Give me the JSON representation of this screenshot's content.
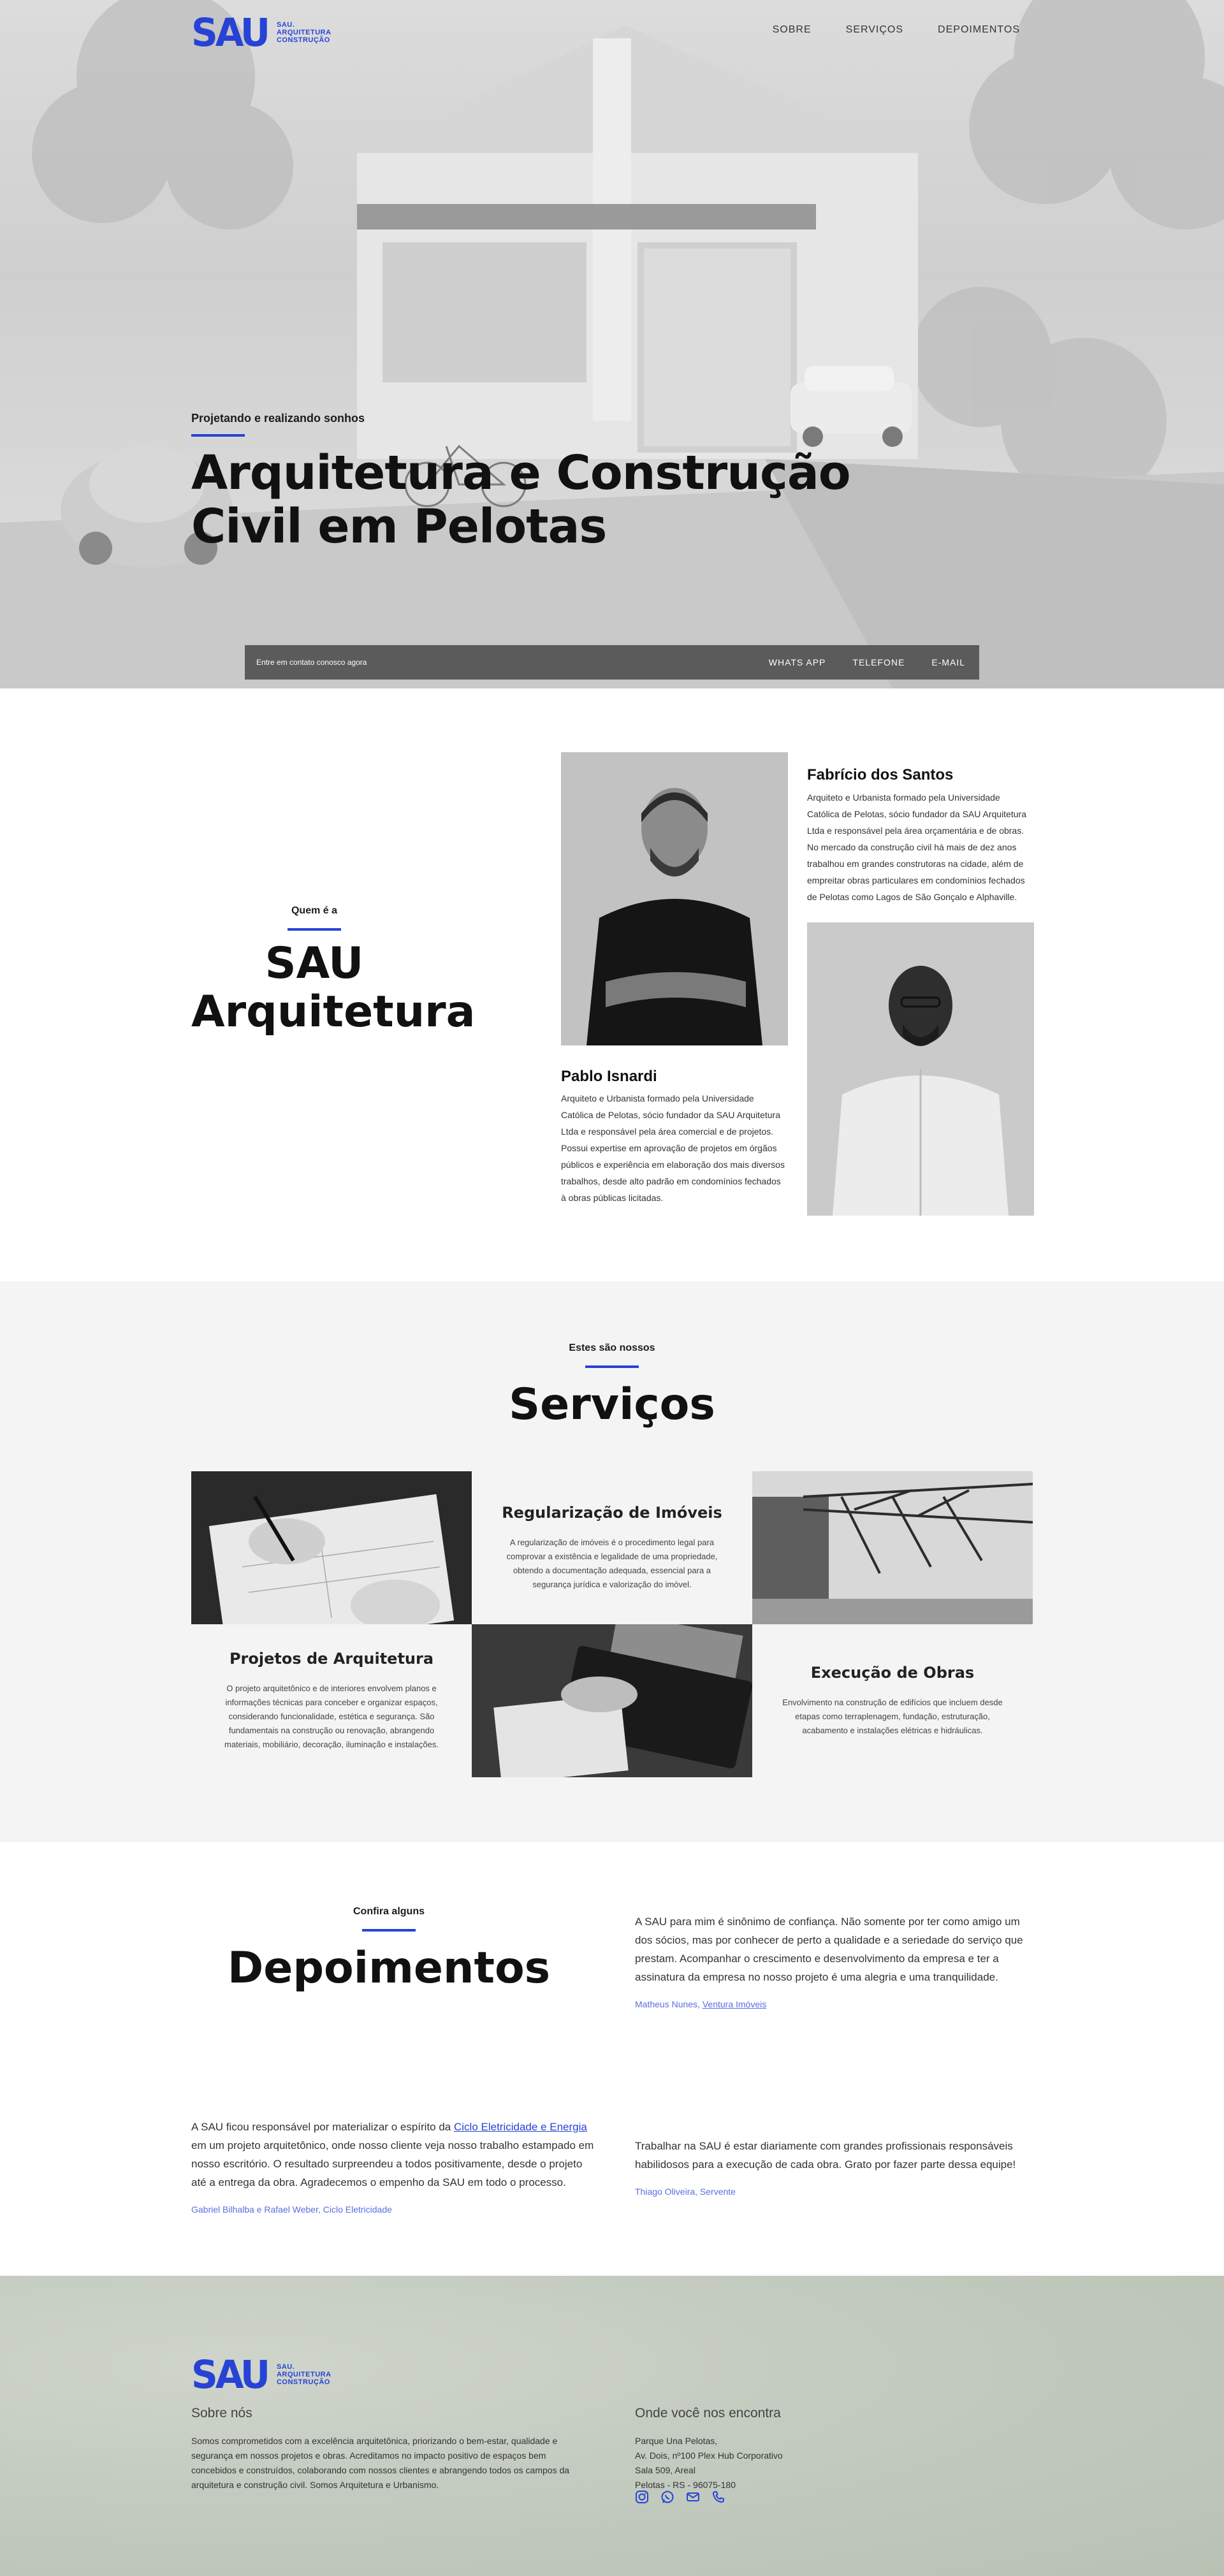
{
  "brand": {
    "mark": "SAU",
    "sub_line1": "SAU.",
    "sub_line2": "ARQUITETURA",
    "sub_line3": "CONSTRUÇÃO",
    "accent_color": "#2743d6"
  },
  "nav": {
    "items": [
      {
        "label": "SOBRE"
      },
      {
        "label": "SERVIÇOS"
      },
      {
        "label": "DEPOIMENTOS"
      }
    ]
  },
  "hero": {
    "kicker": "Projetando e realizando sonhos",
    "title": "Arquitetura e Construção Civil em Pelotas",
    "contact_text": "Entre em contato conosco agora",
    "contact_links": [
      "WHATS APP",
      "TELEFONE",
      "E-MAIL"
    ]
  },
  "about": {
    "kicker": "Quem é a",
    "title": "SAU Arquitetura",
    "people": [
      {
        "name": "Fabrício dos Santos",
        "bio": "Arquiteto e Urbanista formado pela Universidade Católica de Pelotas, sócio fundador da SAU Arquitetura Ltda e responsável pela área orçamentária e de obras. No mercado da construção civil há mais de dez anos trabalhou em grandes construtoras na cidade, além de empreitar obras particulares em condomínios fechados de Pelotas como Lagos de São Gonçalo e Alphaville."
      },
      {
        "name": "Pablo Isnardi",
        "bio": "Arquiteto e Urbanista formado pela Universidade Católica de Pelotas, sócio fundador da SAU Arquitetura Ltda e responsável pela área comercial e de projetos. Possui expertise em aprovação de projetos em órgãos públicos e experiência em elaboração dos mais diversos trabalhos, desde alto padrão em condomínios fechados à obras públicas licitadas."
      }
    ]
  },
  "services": {
    "kicker": "Estes são nossos",
    "title": "Serviços",
    "items": [
      {
        "title": "Regularização de Imóveis",
        "text": "A regularização de imóveis é o procedimento legal para comprovar a existência e legalidade de uma propriedade, obtendo a documentação adequada, essencial para a segurança jurídica e valorização do imóvel."
      },
      {
        "title": "Projetos de Arquitetura",
        "text": "O projeto arquitetônico e de interiores envolvem planos e informações técnicas para conceber e organizar espaços, considerando funcionalidade, estética e segurança. São fundamentais na construção ou renovação, abrangendo materiais, mobiliário, decoração, iluminação e instalações."
      },
      {
        "title": "Execução de Obras",
        "text": "Envolvimento na construção de edifícios que incluem desde etapas como terraplenagem, fundação, estruturação, acabamento e instalações elétricas e hidráulicas."
      }
    ]
  },
  "testimonials": {
    "kicker": "Confira alguns",
    "title": "Depoimentos",
    "items": [
      {
        "text": "A SAU para mim é sinônimo de confiança. Não somente por ter como amigo um dos sócios, mas por conhecer de perto a qualidade e a seriedade do serviço que prestam. Acompanhar o crescimento e desenvolvimento da empresa e ter a assinatura da empresa no nosso projeto é uma alegria e uma tranquilidade.",
        "author": "Matheus Nunes,",
        "company": "Ventura Imóveis"
      },
      {
        "text_before": "A SAU ficou responsável por materializar o espírito da",
        "link": "Ciclo Eletricidade e Energia",
        "text_after": "em um projeto arquitetônico, onde nosso cliente veja nosso trabalho estampado em nosso escritório. O resultado surpreendeu a todos positivamente, desde o projeto até a entrega da obra. Agradecemos o empenho da SAU em todo o processo.",
        "author": "Gabriel Bilhalba e Rafael Weber, Ciclo Eletricidade"
      },
      {
        "text": "Trabalhar na SAU é estar diariamente com grandes profissionais responsáveis habilidosos para a execução de cada obra. Grato por fazer parte dessa equipe!",
        "author": "Thiago Oliveira, Servente"
      }
    ]
  },
  "footer": {
    "about_title": "Sobre nós",
    "about_text": "Somos comprometidos com a excelência arquitetônica, priorizando o bem-estar, qualidade e segurança em nossos projetos e obras. Acreditamos no impacto positivo de espaços bem concebidos e construídos, colaborando com nossos clientes e abrangendo todos os campos da arquitetura e construção civil. Somos Arquitetura e Urbanismo.",
    "location_title": "Onde você nos encontra",
    "address_line1": "Parque Una Pelotas,",
    "address_line2": "Av. Dois, nº100 Plex Hub Corporativo",
    "address_line3": "Sala 509, Areal",
    "address_line4": "Pelotas - RS - 96075-180",
    "social_icons": [
      "instagram-icon",
      "whatsapp-icon",
      "email-icon",
      "phone-icon"
    ]
  }
}
